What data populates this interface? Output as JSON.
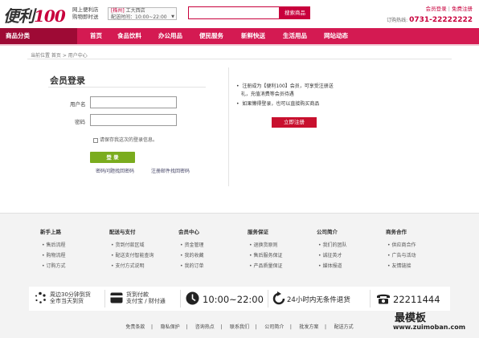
{
  "header": {
    "logo_text": "便利",
    "logo_num": "100",
    "tagline1": "网上便利店",
    "tagline2": "购物即时送",
    "store_city": "[株州]",
    "store_name": "工大西店",
    "store_hours": "配送时间：10:00~22:00",
    "search_btn": "搜索商品",
    "search_placeholder": "",
    "login_link": "会员登录",
    "sep": "|",
    "register_link": "免费注册",
    "hotline_label": "订购热线:",
    "hotline": "0731-22222222"
  },
  "nav": {
    "category": "商品分类",
    "items": [
      "首页",
      "食品饮料",
      "办公用品",
      "便民服务",
      "新鲜快送",
      "生活用品",
      "网站动态"
    ]
  },
  "breadcrumb": "当前位置   首页 > 用户中心",
  "login": {
    "title": "会员登录",
    "username_label": "用户名",
    "password_label": "密码",
    "remember": "请保存我这次的登录信息。",
    "submit": "登 录",
    "link_question": "密码问题找回密码",
    "link_email": "注册邮件找回密码"
  },
  "register": {
    "bullet1a": "注册成为【便利100】会员，可享受注册送",
    "bullet1b": "礼，充值消费等会员待遇",
    "bullet2": "如果懒得登录，也可以直接购买商品",
    "button": "立即注册"
  },
  "footer": {
    "columns": [
      {
        "title": "新手上路",
        "items": [
          "售后流程",
          "购物流程",
          "订购方式"
        ]
      },
      {
        "title": "配送与支付",
        "items": [
          "货到付款区域",
          "配送支付智能查询",
          "支付方式说明"
        ]
      },
      {
        "title": "会员中心",
        "items": [
          "资金管理",
          "我的收藏",
          "我的订单"
        ]
      },
      {
        "title": "服务保证",
        "items": [
          "退换货原则",
          "售后服务保证",
          "产品质量保证"
        ]
      },
      {
        "title": "公司简介",
        "items": [
          "我们的团队",
          "诚征英才",
          "媒体报道"
        ]
      },
      {
        "title": "商务合作",
        "items": [
          "供应商合作",
          "广告与活动",
          "友情链接"
        ]
      }
    ],
    "services": [
      {
        "icon": "delivery-dots-icon",
        "line1": "周边30分钟到货",
        "line2": "全市当天到货"
      },
      {
        "icon": "card-icon",
        "line1": "货到付款",
        "line2": "支付宝 / 财付通"
      },
      {
        "icon": "clock-icon",
        "big": "10:00~22:00"
      },
      {
        "icon": "return-arrow-icon",
        "big": "24小时内无条件退货"
      },
      {
        "icon": "phone-icon",
        "big": "22211444"
      }
    ],
    "links": [
      "免责条款",
      "隐私保护",
      "咨询热点",
      "联系我们",
      "公司简介",
      "批发方案",
      "配送方式"
    ],
    "watermark": "最模板",
    "watermark_url": "www.zuimoban.com"
  },
  "colors": {
    "brand": "#c8003c",
    "nav": "#d41a52",
    "login_button": "#7aac1e",
    "register_button": "#c8102e"
  }
}
